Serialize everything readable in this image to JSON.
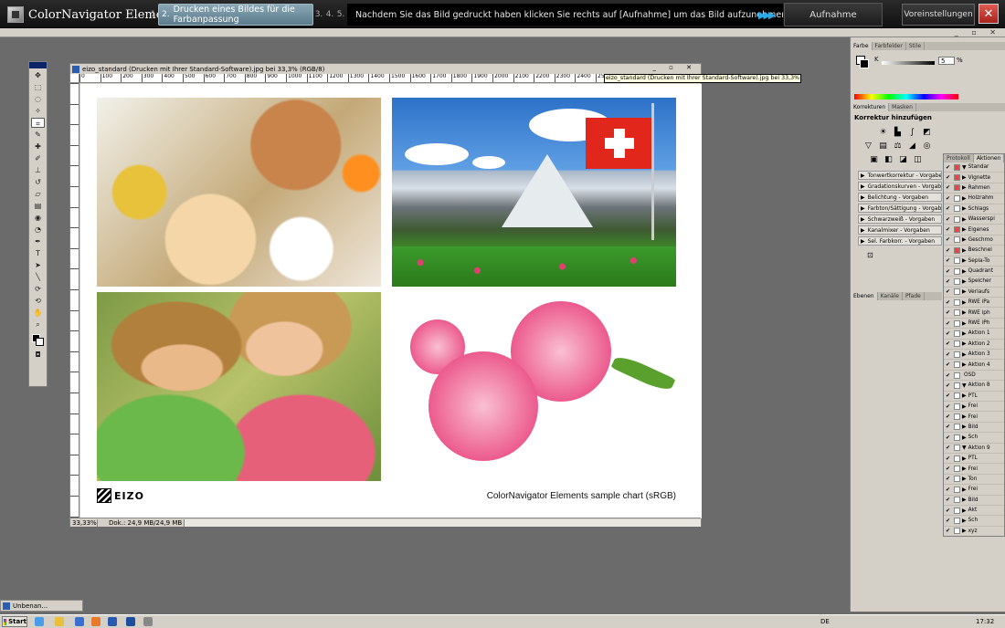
{
  "app": {
    "logo_text": "ColorNavigator Elements",
    "steps": [
      {
        "num": "1."
      },
      {
        "num": "2.",
        "label": "Drucken eines Bildes für die Farbanpassung"
      },
      {
        "num": "3."
      },
      {
        "num": "4."
      },
      {
        "num": "5."
      }
    ],
    "instruction": "Nachdem Sie das Bild gedruckt haben klicken Sie rechts auf [Aufnahme] um das Bild aufzunehmen und anzuzeigen",
    "capture_label": "Aufnahme",
    "settings_label": "Voreinstellungen",
    "close_glyph": "✕",
    "accent_color": "#2aa8e8"
  },
  "document": {
    "title": "eizo_standard (Drucken mit Ihrer Standard-Software).jpg bei 33,3% (RGB/8)",
    "tooltip": "eizo_standard (Drucken mit Ihrer Standard-Software).jpg bei 33,3% (RGB/8)",
    "ruler_ticks": [
      "0",
      "100",
      "200",
      "300",
      "400",
      "500",
      "600",
      "700",
      "800",
      "900",
      "1000",
      "1100",
      "1200",
      "1300",
      "1400",
      "1500",
      "1600",
      "1700",
      "1800",
      "1900",
      "2000",
      "2100",
      "2200",
      "2300",
      "2400",
      "2500",
      "2600",
      "2700",
      "2800",
      "2900",
      "3000"
    ],
    "brand": "EIZO",
    "caption": "ColorNavigator Elements sample chart (sRGB)",
    "zoom": "33,33%",
    "doc_info": "Dok.: 24,9 MB/24,9 MB"
  },
  "panels": {
    "color_tabs": [
      "Farbe",
      "Farbfelder",
      "Stile"
    ],
    "k_label": "K",
    "k_value": "5",
    "k_unit": "%",
    "correction_tabs": [
      "Korrekturen",
      "Masken"
    ],
    "correction_title": "Korrektur hinzufügen",
    "presets": [
      "Tonwertkorrektur - Vorgaben",
      "Gradationskurven - Vorgaben",
      "Belichtung - Vorgaben",
      "Farbton/Sättigung - Vorgaben",
      "Schwarzweiß - Vorgaben",
      "Kanalmixer - Vorgaben",
      "Sel. Farbkorr. - Vorgaben"
    ],
    "layer_tabs": [
      "Ebenen",
      "Kanäle",
      "Pfade"
    ],
    "action_tabs": [
      "Protokoll",
      "Aktionen"
    ],
    "actions": [
      {
        "label": "Standar",
        "dlg": "red",
        "tri": "▼"
      },
      {
        "label": "Vignette",
        "dlg": "red",
        "tri": "▶"
      },
      {
        "label": "Rahmen",
        "dlg": "red",
        "tri": "▶"
      },
      {
        "label": "Holzrahm",
        "dlg": "",
        "tri": "▶"
      },
      {
        "label": "Schlags",
        "dlg": "",
        "tri": "▶"
      },
      {
        "label": "Wasserspi",
        "dlg": "",
        "tri": "▶"
      },
      {
        "label": "Eigenes",
        "dlg": "red",
        "tri": "▶"
      },
      {
        "label": "Geschmo",
        "dlg": "",
        "tri": "▶"
      },
      {
        "label": "Beschnei",
        "dlg": "red",
        "tri": "▶"
      },
      {
        "label": "Sepia-To",
        "dlg": "",
        "tri": "▶"
      },
      {
        "label": "Quadrant",
        "dlg": "",
        "tri": "▶"
      },
      {
        "label": "Speicher",
        "dlg": "",
        "tri": "▶"
      },
      {
        "label": "Verlaufs",
        "dlg": "",
        "tri": "▶"
      },
      {
        "label": "RWE iPa",
        "dlg": "",
        "tri": "▶"
      },
      {
        "label": "RWE iph",
        "dlg": "",
        "tri": "▶"
      },
      {
        "label": "RWE iPh",
        "dlg": "",
        "tri": "▶"
      },
      {
        "label": "Aktion 1",
        "dlg": "",
        "tri": "▶"
      },
      {
        "label": "Aktion 2",
        "dlg": "",
        "tri": "▶"
      },
      {
        "label": "Aktion 3",
        "dlg": "",
        "tri": "▶"
      },
      {
        "label": "Aktion 4",
        "dlg": "",
        "tri": "▶"
      },
      {
        "label": "OSD",
        "dlg": "",
        "tri": ""
      },
      {
        "label": "Aktion 8",
        "dlg": "",
        "tri": "▼"
      },
      {
        "label": "PTL",
        "dlg": "",
        "tri": "▶"
      },
      {
        "label": "Frei",
        "dlg": "",
        "tri": "▶"
      },
      {
        "label": "Frei",
        "dlg": "",
        "tri": "▶"
      },
      {
        "label": "Bild",
        "dlg": "",
        "tri": "▶"
      },
      {
        "label": "Sch",
        "dlg": "",
        "tri": "▶"
      },
      {
        "label": "Aktion 9",
        "dlg": "",
        "tri": "▼"
      },
      {
        "label": "PTL",
        "dlg": "",
        "tri": "▶"
      },
      {
        "label": "Frei",
        "dlg": "",
        "tri": "▶"
      },
      {
        "label": "Ton",
        "dlg": "",
        "tri": "▶"
      },
      {
        "label": "Frei",
        "dlg": "",
        "tri": "▶"
      },
      {
        "label": "Bild",
        "dlg": "",
        "tri": "▶"
      },
      {
        "label": "Akt",
        "dlg": "",
        "tri": "▶"
      },
      {
        "label": "Sch",
        "dlg": "",
        "tri": "▶"
      },
      {
        "label": "xyz",
        "dlg": "",
        "tri": "▶"
      }
    ]
  },
  "taskbar": {
    "window_label": "Unbenan...",
    "start_label": "Start",
    "lang": "DE",
    "clock": "17:32"
  }
}
